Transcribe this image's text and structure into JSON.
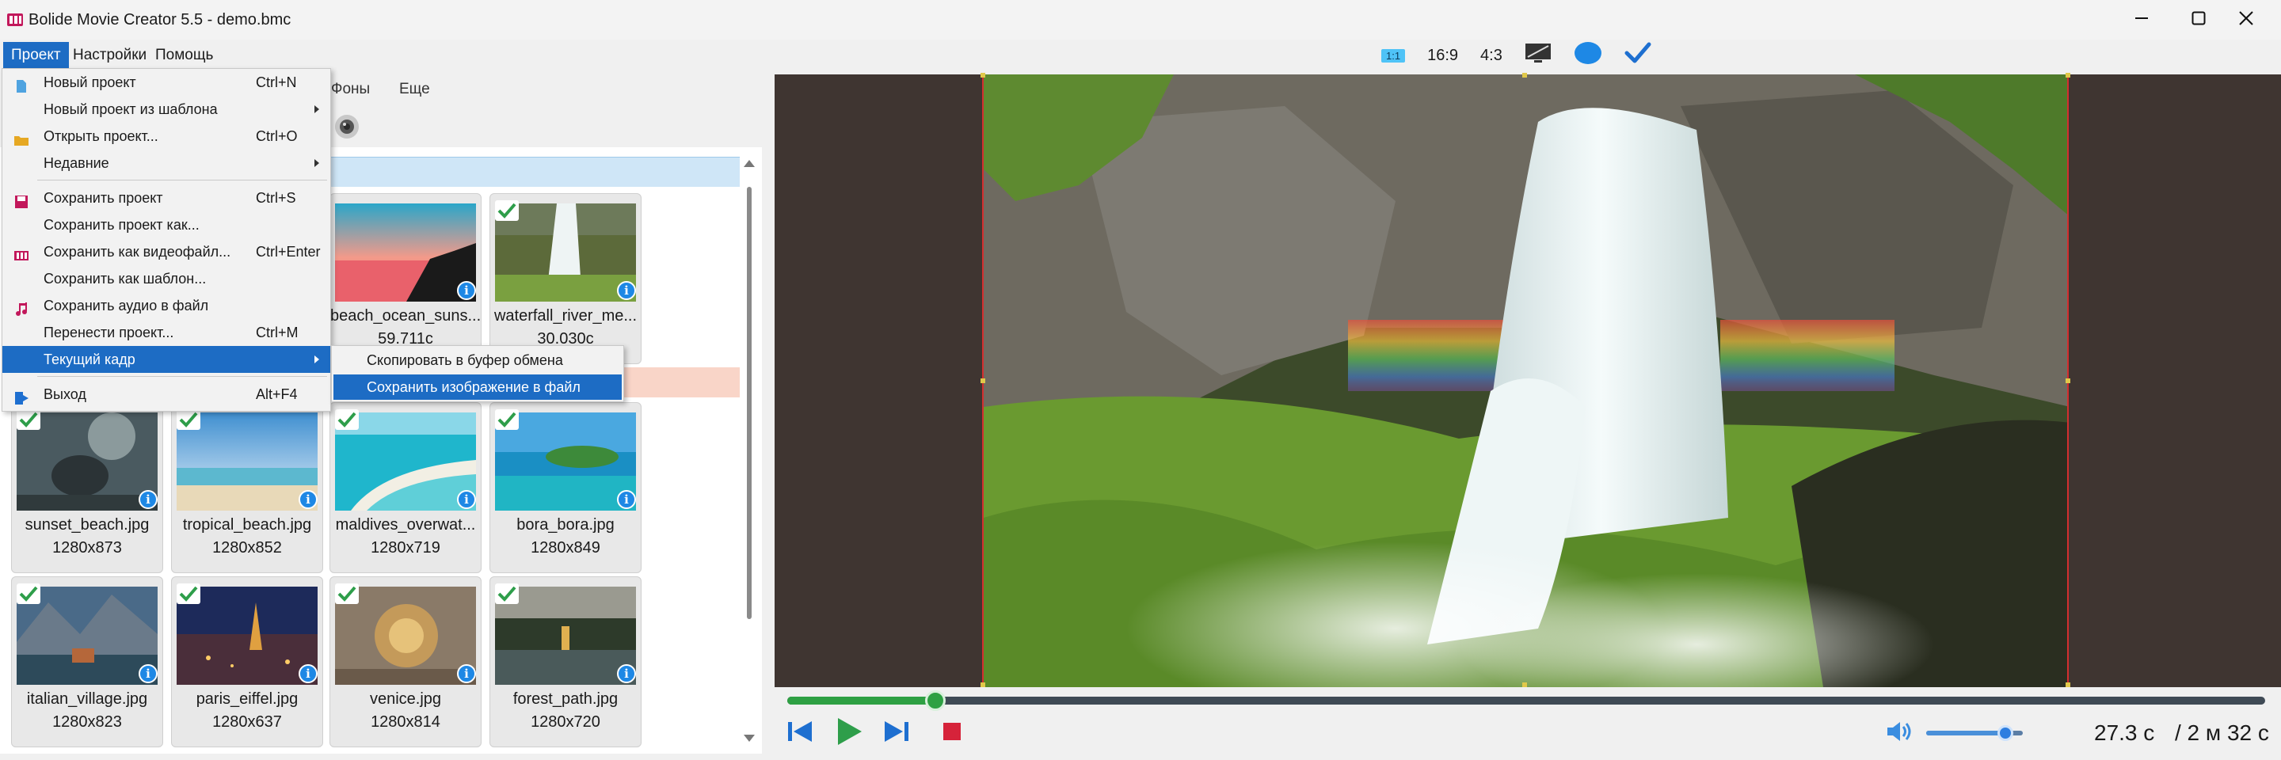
{
  "window": {
    "title": "Bolide Movie Creator 5.5 - demo.bmc",
    "controls": [
      "minimize-icon",
      "maximize-icon",
      "close-icon"
    ]
  },
  "menubar": {
    "items": [
      {
        "label": "Проект",
        "active": true
      },
      {
        "label": "Настройки"
      },
      {
        "label": "Помощь"
      }
    ]
  },
  "aspect_toolbar": {
    "items": [
      {
        "label": "1:1",
        "kind": "badge"
      },
      {
        "label": "16:9"
      },
      {
        "label": "4:3"
      },
      {
        "icon": "monitor-icon"
      },
      {
        "icon": "blue-circle-icon"
      },
      {
        "icon": "checkmark-icon"
      }
    ]
  },
  "left_panel": {
    "tabs": [
      {
        "label": "Фоны"
      },
      {
        "label": "Еще"
      }
    ],
    "rows": [
      [
        {
          "name": "beach_ocean_suns...",
          "size": "59.711c",
          "icon": "sunset-thumbnail"
        },
        {
          "name": "waterfall_river_me...",
          "size": "30.030c",
          "icon": "waterfall-thumbnail"
        }
      ],
      [
        {
          "name": "sunset_beach.jpg",
          "size": "1280x873",
          "icon": "elephant-thumbnail"
        },
        {
          "name": "tropical_beach.jpg",
          "size": "1280x852",
          "icon": "beach-thumbnail"
        },
        {
          "name": "maldives_overwat...",
          "size": "1280x719",
          "icon": "maldives-thumbnail"
        },
        {
          "name": "bora_bora.jpg",
          "size": "1280x849",
          "icon": "island-thumbnail"
        }
      ],
      [
        {
          "name": "italian_village.jpg",
          "size": "1280x823",
          "icon": "village-thumbnail"
        },
        {
          "name": "paris_eiffel.jpg",
          "size": "1280x637",
          "icon": "city-night-thumbnail"
        },
        {
          "name": "venice.jpg",
          "size": "1280x814",
          "icon": "lion-thumbnail"
        },
        {
          "name": "forest_path.jpg",
          "size": "1280x720",
          "icon": "forest-thumbnail"
        }
      ]
    ]
  },
  "project_menu": {
    "items": [
      {
        "label": "Новый проект",
        "shortcut": "Ctrl+N",
        "icon": "new-file-icon"
      },
      {
        "label": "Новый проект из шаблона",
        "submenu": true
      },
      {
        "label": "Открыть проект...",
        "shortcut": "Ctrl+O",
        "icon": "folder-icon"
      },
      {
        "label": "Недавние",
        "submenu": true
      },
      {
        "label": "Сохранить проект",
        "shortcut": "Ctrl+S",
        "icon": "save-icon"
      },
      {
        "label": "Сохранить проект как..."
      },
      {
        "label": "Сохранить как видеофайл...",
        "shortcut": "Ctrl+Enter",
        "icon": "film-icon"
      },
      {
        "label": "Сохранить как шаблон..."
      },
      {
        "label": "Сохранить аудио в файл",
        "icon": "music-icon"
      },
      {
        "label": "Перенести проект...",
        "shortcut": "Ctrl+M"
      },
      {
        "label": "Текущий кадр",
        "submenu": true,
        "highlighted": true
      },
      {
        "label": "Выход",
        "shortcut": "Alt+F4",
        "icon": "exit-icon"
      }
    ],
    "submenu_current_frame": [
      {
        "label": "Скопировать в буфер обмена"
      },
      {
        "label": "Сохранить изображение в файл",
        "highlighted": true
      }
    ]
  },
  "playback": {
    "progress": 0.1,
    "volume": 0.82,
    "current_time": "27.3 с",
    "total_time": "/ 2 м 32 с"
  },
  "colors": {
    "accent": "#1d6cc4",
    "progress": "#2ea043",
    "preview_bg": "#3f3531",
    "group_band_blue": "#cfe6f7",
    "group_band_peach": "#f9d5c8"
  }
}
